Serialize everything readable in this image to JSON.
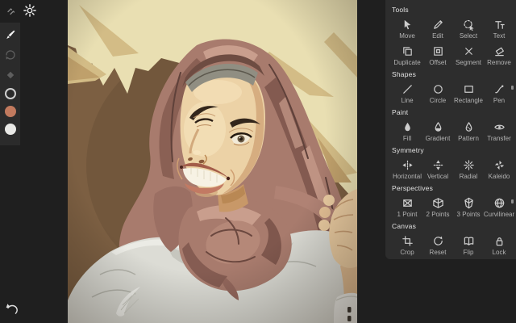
{
  "app": {
    "name": "vector-drawing-app"
  },
  "header": {
    "icons": [
      {
        "name": "collapse-icon"
      },
      {
        "name": "settings-gear-icon"
      }
    ]
  },
  "left_toolbar": {
    "tools": [
      {
        "name": "brush-tool",
        "icon": "brush",
        "active": true
      },
      {
        "name": "rotate-tool",
        "icon": "rotate",
        "active": false
      },
      {
        "name": "eraser-tool",
        "icon": "eraser",
        "active": false
      }
    ],
    "swatches": [
      {
        "name": "stroke-none-swatch",
        "type": "ring",
        "color": "transparent"
      },
      {
        "name": "fill-color-swatch",
        "type": "solid",
        "color": "#c27a5e"
      },
      {
        "name": "secondary-color-swatch",
        "type": "solid",
        "color": "#e9e9e6"
      }
    ]
  },
  "undo": {
    "name": "undo-button",
    "icon": "undo"
  },
  "canvas": {
    "description": "vector portrait artwork of a smiling woman wearing a rosy-brown hijab over a light gray garment, cream abstract background shapes on brown",
    "palette": {
      "background_brown": "#78593d",
      "background_cream": "#e9dfb2",
      "background_tan": "#d3bc86",
      "hijab_base": "#a87b6d",
      "hijab_highlight": "#c99e8d",
      "hijab_shadow": "#7e574d",
      "skin_light": "#ecd2a6",
      "skin_shadow": "#d6ad80",
      "cap_gray": "#908e82",
      "shirt_gray": "#dcdcd5",
      "teeth_white": "#f7f2e4",
      "lip": "#c27a63"
    }
  },
  "panel": {
    "sections": [
      {
        "title": "Tools",
        "items": [
          {
            "label": "Move",
            "icon": "move"
          },
          {
            "label": "Edit",
            "icon": "edit"
          },
          {
            "label": "Select",
            "icon": "select"
          },
          {
            "label": "Text",
            "icon": "text"
          },
          {
            "label": "Duplicate",
            "icon": "duplicate"
          },
          {
            "label": "Offset",
            "icon": "offset"
          },
          {
            "label": "Segment",
            "icon": "segment"
          },
          {
            "label": "Remove",
            "icon": "remove"
          }
        ]
      },
      {
        "title": "Shapes",
        "items": [
          {
            "label": "Line",
            "icon": "line"
          },
          {
            "label": "Circle",
            "icon": "circle"
          },
          {
            "label": "Rectangle",
            "icon": "rectangle"
          },
          {
            "label": "Pen",
            "icon": "pen",
            "corner_mark": true
          }
        ]
      },
      {
        "title": "Paint",
        "items": [
          {
            "label": "Fill",
            "icon": "fill"
          },
          {
            "label": "Gradient",
            "icon": "gradient"
          },
          {
            "label": "Pattern",
            "icon": "pattern"
          },
          {
            "label": "Transfer",
            "icon": "transfer"
          }
        ]
      },
      {
        "title": "Symmetry",
        "items": [
          {
            "label": "Horizontal",
            "icon": "horizontal"
          },
          {
            "label": "Vertical",
            "icon": "vertical"
          },
          {
            "label": "Radial",
            "icon": "radial"
          },
          {
            "label": "Kaleido",
            "icon": "kaleido"
          }
        ]
      },
      {
        "title": "Perspectives",
        "items": [
          {
            "label": "1 Point",
            "icon": "p1"
          },
          {
            "label": "2 Points",
            "icon": "p2"
          },
          {
            "label": "3 Points",
            "icon": "p3"
          },
          {
            "label": "Curvilinear",
            "icon": "curvilinear",
            "corner_mark": true
          }
        ]
      },
      {
        "title": "Canvas",
        "items": [
          {
            "label": "Crop",
            "icon": "crop"
          },
          {
            "label": "Reset",
            "icon": "reset"
          },
          {
            "label": "Flip",
            "icon": "flip"
          },
          {
            "label": "Lock",
            "icon": "lock"
          }
        ]
      }
    ]
  }
}
